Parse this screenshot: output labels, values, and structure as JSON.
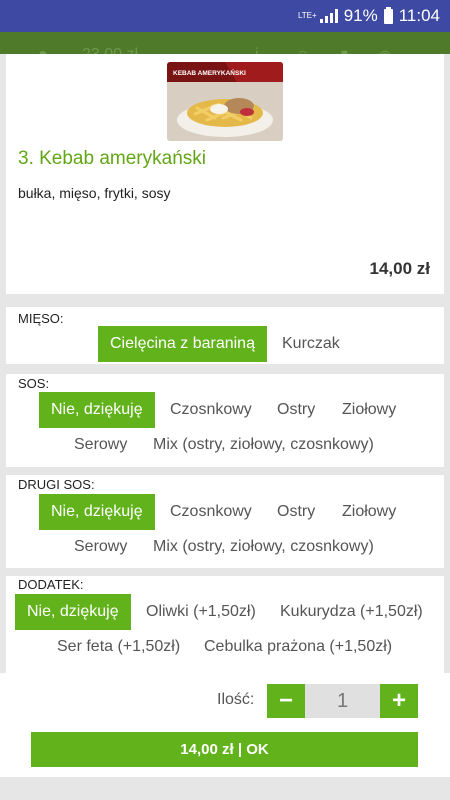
{
  "status_bar": {
    "network_label": "LTE+",
    "battery_percent": "91%",
    "time": "11:04"
  },
  "app_bar": {
    "background_total": "23,00 zł"
  },
  "product": {
    "image_caption": "KEBAB AMERYKAŃSKI",
    "title": "3. Kebab amerykański",
    "description": "bułka, mięso, frytki, sosy",
    "price": "14,00 zł"
  },
  "groups": {
    "mieso": {
      "title": "MIĘSO:",
      "options": [
        "Cielęcina z baraniną",
        "Kurczak"
      ],
      "selected": "Cielęcina z baraniną"
    },
    "sos": {
      "title": "SOS:",
      "options": [
        "Nie, dziękuję",
        "Czosnkowy",
        "Ostry",
        "Ziołowy",
        "Serowy",
        "Mix (ostry, ziołowy, czosnkowy)"
      ],
      "selected": "Nie, dziękuję"
    },
    "drugi_sos": {
      "title": "DRUGI SOS:",
      "options": [
        "Nie, dziękuję",
        "Czosnkowy",
        "Ostry",
        "Ziołowy",
        "Serowy",
        "Mix (ostry, ziołowy, czosnkowy)"
      ],
      "selected": "Nie, dziękuję"
    },
    "dodatek": {
      "title": "DODATEK:",
      "options": [
        "Nie, dziękuję",
        "Oliwki (+1,50zł)",
        "Kukurydza (+1,50zł)",
        "Ser feta (+1,50zł)",
        "Cebulka prażona (+1,50zł)"
      ],
      "selected": "Nie, dziękuję"
    }
  },
  "quantity": {
    "label": "Ilość:",
    "minus": "−",
    "plus": "+",
    "value": "1"
  },
  "ok_button": "14,00 zł | OK",
  "colors": {
    "accent": "#62b21c",
    "title_green": "#62a615",
    "status_bar": "#3e49a3",
    "app_bar": "#4e7a2a"
  }
}
